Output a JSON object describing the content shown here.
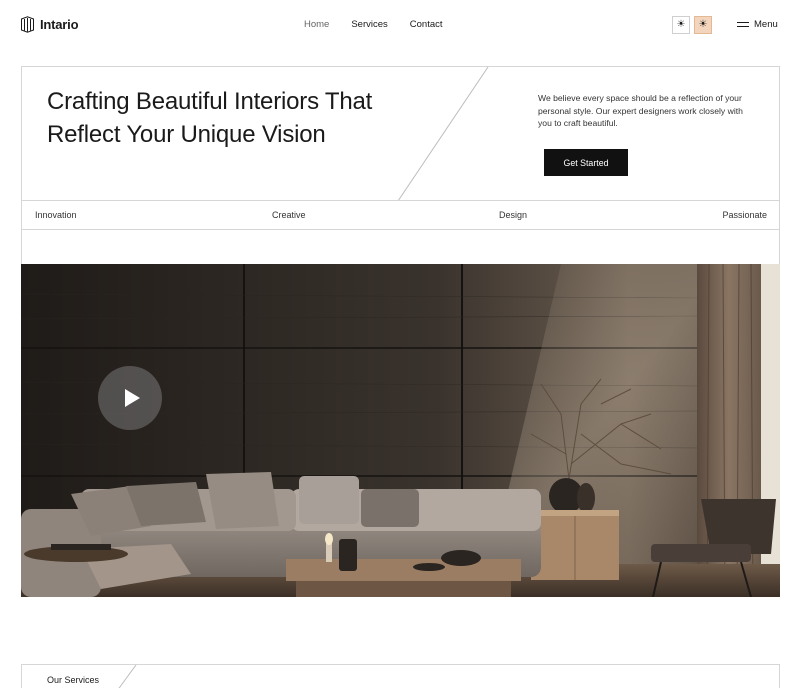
{
  "brand": {
    "name": "Intario"
  },
  "nav": {
    "home": "Home",
    "services": "Services",
    "contact": "Contact"
  },
  "theme": {
    "light_icon": "sun-icon",
    "dark_icon": "sun-icon",
    "light_glyph": "☀",
    "dark_glyph": "☀",
    "active_color": "#f3d5bd"
  },
  "menu": {
    "label": "Menu",
    "icon": "hamburger-icon"
  },
  "hero": {
    "title": "Crafting Beautiful Interiors That Reflect Your Unique Vision",
    "description": "We believe every space should be a reflection of your personal style. Our expert designers work closely with you to craft beautiful.",
    "cta_label": "Get Started"
  },
  "tags": [
    "Innovation",
    "Creative",
    "Design",
    "Passionate"
  ],
  "media": {
    "play_icon": "play-icon"
  },
  "services": {
    "label": "Our Services"
  }
}
